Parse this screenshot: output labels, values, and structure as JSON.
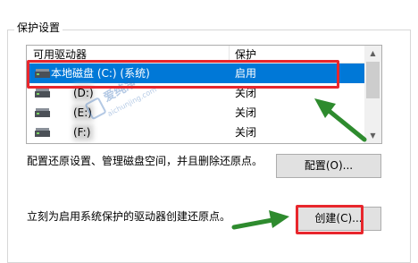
{
  "section_title": "保护设置",
  "list": {
    "col_drive_header": "可用驱动器",
    "col_protection_header": "保护",
    "rows": [
      {
        "drive": "本地磁盘 (C:) (系统)",
        "protection": "启用",
        "selected": true
      },
      {
        "drive": "(D:)",
        "protection": "关闭",
        "selected": false
      },
      {
        "drive": "(E:)",
        "protection": "关闭",
        "selected": false
      },
      {
        "drive": "(F:)",
        "protection": "关闭",
        "selected": false
      }
    ]
  },
  "configure": {
    "description": "配置还原设置、管理磁盘空间，并且删除还原点。",
    "button_label": "配置(O)..."
  },
  "create": {
    "description": "立刻为启用系统保护的驱动器创建还原点。",
    "button_label": "创建(C)..."
  },
  "watermark": {
    "cn": "爱纯净",
    "en": "aichunjing.com"
  },
  "colors": {
    "selection": "#0078d7",
    "annotation_red": "#e8262c",
    "annotation_green": "#2e8b2e"
  }
}
